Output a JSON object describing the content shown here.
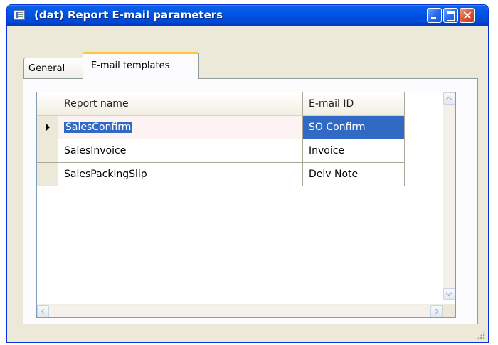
{
  "window": {
    "title": "(dat) Report E-mail parameters"
  },
  "tabs": [
    {
      "label": "General",
      "active": false
    },
    {
      "label": "E-mail templates",
      "active": true
    }
  ],
  "grid": {
    "columns": [
      "Report name",
      "E-mail ID"
    ],
    "rows": [
      {
        "report_name": "SalesConfirm",
        "email_id": "SO Confirm",
        "current": true
      },
      {
        "report_name": "SalesInvoice",
        "email_id": "Invoice",
        "current": false
      },
      {
        "report_name": "SalesPackingSlip",
        "email_id": "Delv Note",
        "current": false
      }
    ]
  },
  "icons": {
    "window": "form-window-icon",
    "minimize": "minimize-icon",
    "maximize": "maximize-icon",
    "close": "close-icon",
    "current_row": "current-row-arrow-icon",
    "scroll_up": "scroll-up-arrow-icon",
    "scroll_down": "scroll-down-arrow-icon",
    "scroll_left": "scroll-left-arrow-icon",
    "scroll_right": "scroll-right-arrow-icon",
    "resize_grip": "resize-grip-icon"
  },
  "colors": {
    "titlebar": "#0055e5",
    "selection": "#316ac5",
    "active_tab_accent": "#ffc83c",
    "window_bg": "#ece9d8"
  }
}
